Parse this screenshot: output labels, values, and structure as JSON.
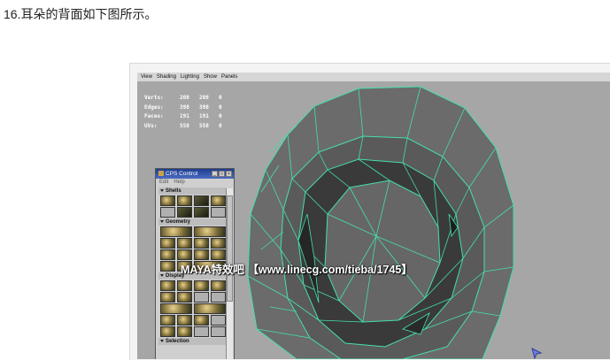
{
  "caption": "16.耳朵的背面如下图所示。",
  "viewport_menu": [
    "View",
    "Shading",
    "Lighting",
    "Show",
    "Panels"
  ],
  "hud": [
    {
      "label": "Verts:",
      "v1": "208",
      "v2": "208",
      "v3": "0"
    },
    {
      "label": "Edges:",
      "v1": "398",
      "v2": "398",
      "v3": "0"
    },
    {
      "label": "Faces:",
      "v1": "191",
      "v2": "191",
      "v3": "0"
    },
    {
      "label": "UVs:",
      "v1": "558",
      "v2": "558",
      "v3": "0"
    }
  ],
  "cps_window": {
    "title": "CPS Control",
    "menu": [
      "Edit",
      "Help"
    ],
    "window_buttons": [
      "_",
      "□",
      "×"
    ],
    "sections": [
      "Shells",
      "Geometry",
      "Display",
      "Selection"
    ]
  },
  "watermark": "MAYA特效吧 【www.linecg.com/tieba/1745】",
  "colors": {
    "wire": "#46e0a8",
    "mesh_fill": "#6b6b6b",
    "viewport_bg": "#a6a6a6",
    "title_bar": "#1d3c8e"
  }
}
